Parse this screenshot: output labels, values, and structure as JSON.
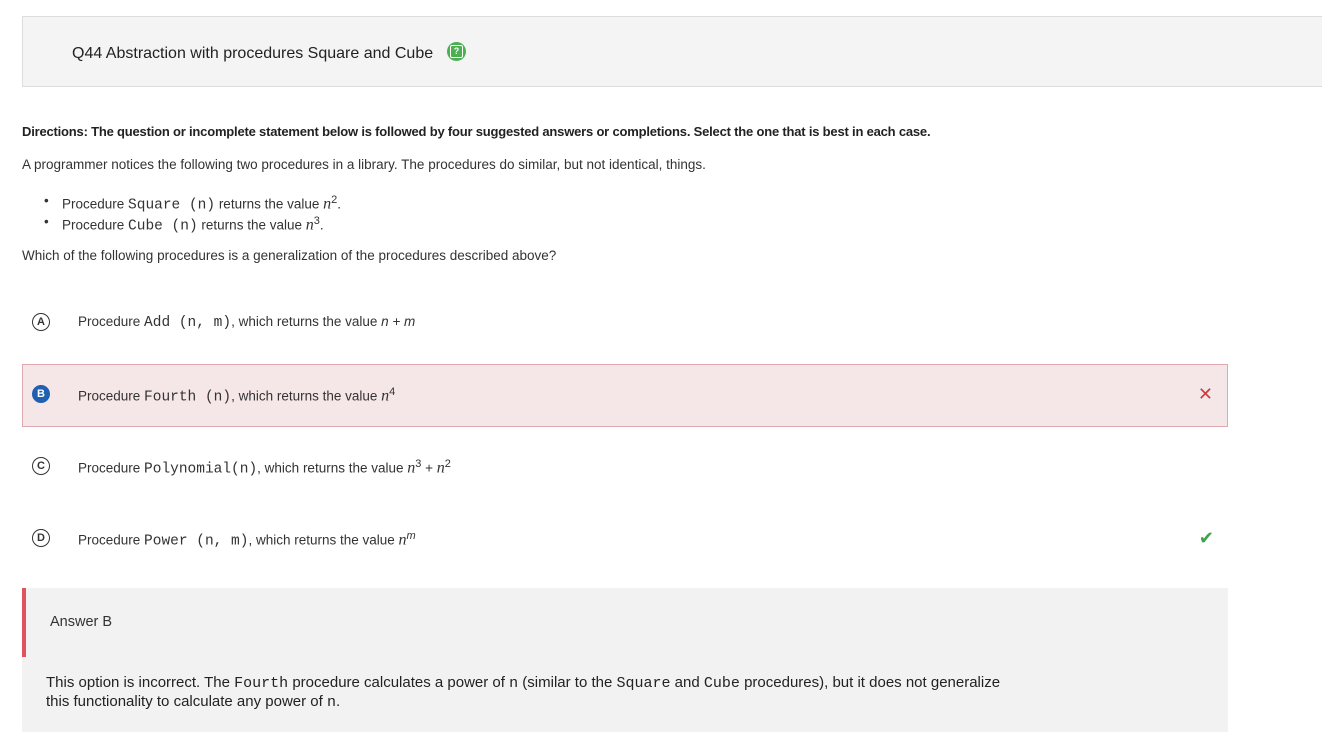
{
  "header": {
    "title": "Q44 Abstraction with procedures Square and Cube"
  },
  "directions": "Directions: The question or incomplete statement below is followed by four suggested answers or completions. Select the one that is best in each case.",
  "intro": "A programmer notices the following two procedures in a library. The procedures do similar, but not identical, things.",
  "bullets": [
    {
      "prefix": "Procedure ",
      "code": "Square (n)",
      "text": " returns the value ",
      "base": "n",
      "exp": "2",
      "end": "."
    },
    {
      "prefix": "Procedure ",
      "code": "Cube (n)",
      "text": " returns the value ",
      "base": "n",
      "exp": "3",
      "end": "."
    }
  ],
  "question": "Which of the following procedures is a generalization of the procedures described above?",
  "options": [
    {
      "letter": "A",
      "prefix": "Procedure ",
      "code": "Add (n, m)",
      "text": ", which returns the value ",
      "math": "n + m"
    },
    {
      "letter": "B",
      "prefix": "Procedure ",
      "code": "Fourth (n)",
      "text": ", which returns the value ",
      "base": "n",
      "exp": "4"
    },
    {
      "letter": "C",
      "prefix": "Procedure ",
      "code": "Polynomial(n)",
      "text": ", which returns the value ",
      "base1": "n",
      "exp1": "3",
      "plus": " + ",
      "base2": "n",
      "exp2": "2"
    },
    {
      "letter": "D",
      "prefix": "Procedure ",
      "code": "Power (n, m)",
      "text": ", which returns the value ",
      "base": "n",
      "exp": "m"
    }
  ],
  "marks": {
    "wrong": "✕",
    "correct": "✔"
  },
  "colors": {
    "wrong_bg": "#f5e6e8",
    "wrong_border": "#e0a8b0",
    "wrong_mark": "#d0393e",
    "correct_mark": "#3aa54a",
    "selected_badge": "#2060b0",
    "help_icon": "#4caf50"
  },
  "answer": {
    "title": "Answer B",
    "exp_1": "This option is incorrect. The ",
    "exp_code_1": "Fourth",
    "exp_2": " procedure calculates a power of ",
    "exp_code_2": "n",
    "exp_3": " (similar to the ",
    "exp_code_3": "Square",
    "exp_4": " and ",
    "exp_code_4": "Cube",
    "exp_5": " procedures), but it does not generalize this functionality to calculate any power of ",
    "exp_code_5": "n",
    "exp_6": "."
  }
}
